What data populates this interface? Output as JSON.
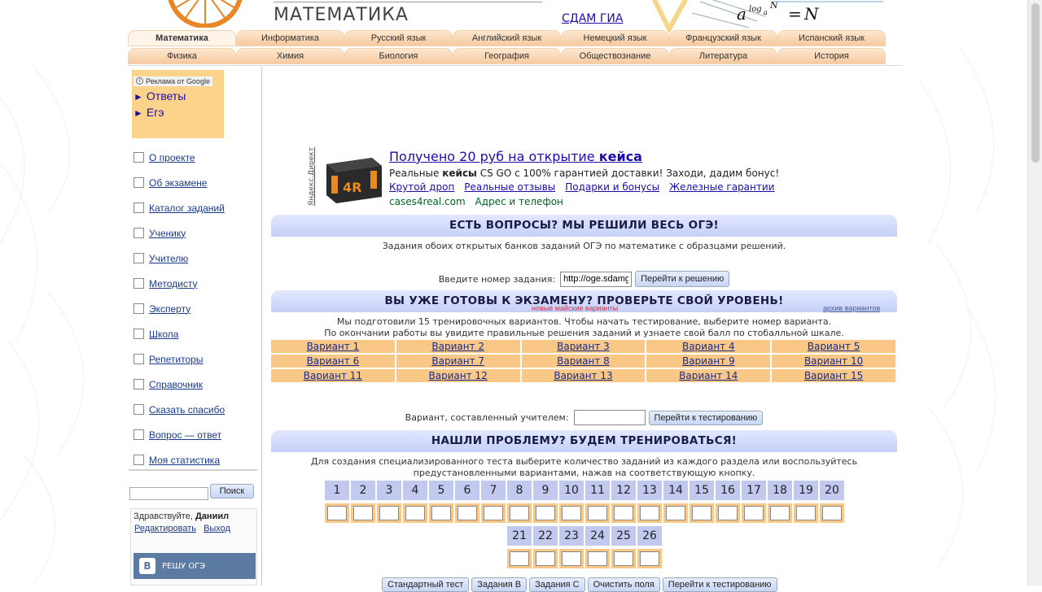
{
  "header": {
    "subject_title": "МАТЕМАТИКА",
    "exam_link": "СДАМ ГИА",
    "formula_text": "a log N = N"
  },
  "tabs": {
    "row1": [
      "Математика",
      "Информатика",
      "Русский язык",
      "Английский язык",
      "Немецкий язык",
      "Французский язык",
      "Испанский язык"
    ],
    "row2": [
      "Физика",
      "Химия",
      "Биология",
      "География",
      "Обществознание",
      "Литература",
      "История"
    ]
  },
  "sidebar": {
    "ad_badge": "Реклама от Google",
    "ad_links": [
      "Ответы",
      "Егэ"
    ],
    "menu": [
      "О проекте",
      "Об экзамене",
      "Каталог заданий",
      "Ученику",
      "Учителю",
      "Методисту",
      "Эксперту",
      "Школа",
      "Репетиторы",
      "Справочник",
      "Сказать спасибо",
      "Вопрос — ответ",
      "Моя статистика"
    ],
    "search_button": "Поиск",
    "greeting": "Здравствуйте,",
    "user_name": "Даниил",
    "edit_link": "Редактировать",
    "logout_link": "Выход",
    "vk_label": "РЕШУ ОГЭ"
  },
  "yandex_ad": {
    "side_label": "Яндекс.Директ",
    "title_prefix": "Получено 20 руб на открытие",
    "title_bold": "кейса",
    "desc_prefix": "Реальные",
    "desc_bold": "кейсы",
    "desc_suffix": "CS GO с 100% гарантией доставки! Заходи, дадим бонус!",
    "sublinks": [
      "Крутой дроп",
      "Реальные отзывы",
      "Подарки и бонусы",
      "Железные гарантии"
    ],
    "domain": "cases4real.com",
    "contacts": "Адрес и телефон"
  },
  "section1": {
    "banner": "ЕСТЬ ВОПРОСЫ? МЫ РЕШИЛИ ВЕСЬ ОГЭ!",
    "text": "Задания обоих открытых банков заданий ОГЭ по математике с образцами решений.",
    "task_label": "Введите номер задания:",
    "task_value": "http://oge.sdamgia.ru",
    "task_button": "Перейти к решению"
  },
  "section2": {
    "banner": "ВЫ УЖЕ ГОТОВЫ К ЭКЗАМЕНУ? ПРОВЕРЬТЕ СВОЙ УРОВЕНЬ!",
    "new_variants": "новые майские варианты",
    "archive": "архив вариантов",
    "text1": "Мы подготовили 15 тренировочных вариантов. Чтобы начать тестирование, выберите номер варианта.",
    "text2": "По окончании работы вы увидите правильные решения заданий и узнаете свой балл по стобалльной шкале.",
    "variants": [
      "Вариант 1",
      "Вариант 2",
      "Вариант 3",
      "Вариант 4",
      "Вариант 5",
      "Вариант 6",
      "Вариант 7",
      "Вариант 8",
      "Вариант 9",
      "Вариант 10",
      "Вариант 11",
      "Вариант 12",
      "Вариант 13",
      "Вариант 14",
      "Вариант 15"
    ],
    "teacher_label": "Вариант, составленный учителем:",
    "teacher_button": "Перейти к тестированию"
  },
  "section3": {
    "banner": "НАШЛИ ПРОБЛЕМУ? БУДЕМ ТРЕНИРОВАТЬСЯ!",
    "text1": "Для создания специализированного теста выберите количество заданий из каждого раздела или воспользуйтесь",
    "text2": "предустановленными вариантами, нажав на соответствующую кнопку.",
    "numbers_row1": [
      "1",
      "2",
      "3",
      "4",
      "5",
      "6",
      "7",
      "8",
      "9",
      "10",
      "11",
      "12",
      "13",
      "14",
      "15",
      "16",
      "17",
      "18",
      "19",
      "20"
    ],
    "numbers_row2": [
      "21",
      "22",
      "23",
      "24",
      "25",
      "26"
    ],
    "buttons": [
      "Стандартный тест",
      "Задания В",
      "Задания С",
      "Очистить поля",
      "Перейти к тестированию"
    ]
  }
}
